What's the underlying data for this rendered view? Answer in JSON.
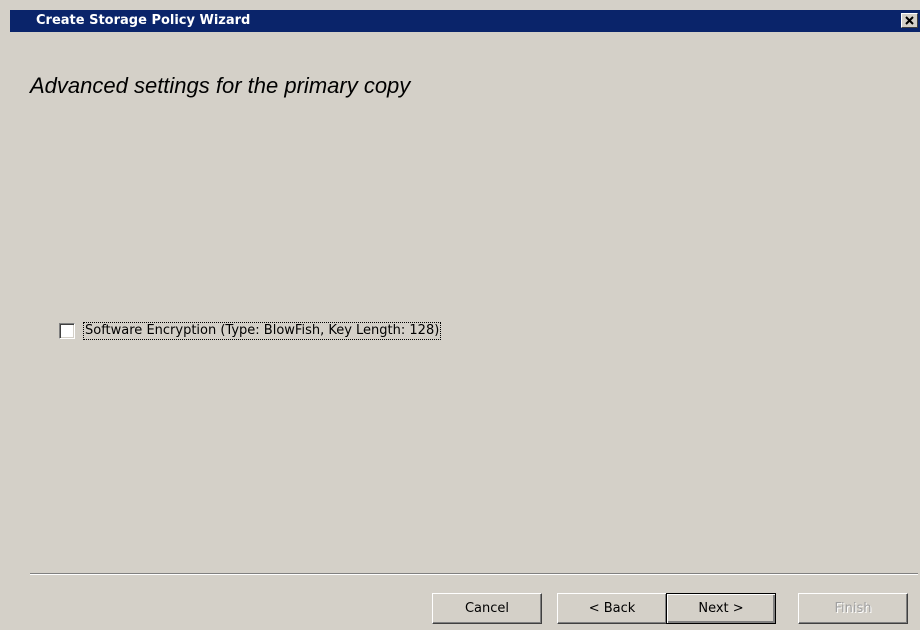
{
  "window": {
    "title": "Create Storage Policy Wizard",
    "close_icon": "close-icon"
  },
  "page": {
    "heading": "Advanced settings for the primary copy"
  },
  "options": {
    "software_encryption": {
      "label": "Software Encryption (Type: BlowFish, Key Length: 128)",
      "checked": false
    }
  },
  "buttons": {
    "cancel": "Cancel",
    "back": "< Back",
    "next": "Next >",
    "finish": "Finish"
  },
  "colors": {
    "titlebar": "#0a246a",
    "face": "#d4d0c8"
  }
}
